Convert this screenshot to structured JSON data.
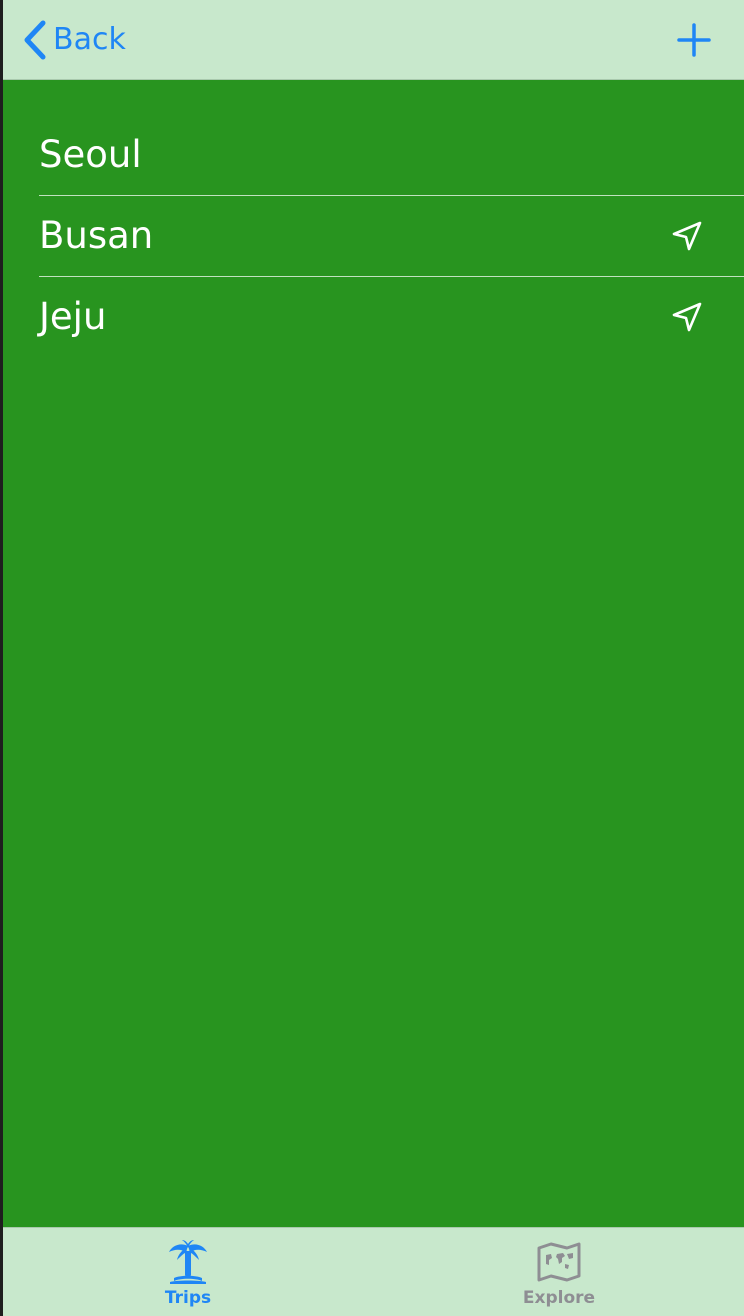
{
  "navbar": {
    "back_label": "Back",
    "back_icon": "chevron-left-icon",
    "add_icon": "plus-icon"
  },
  "list": {
    "items": [
      {
        "label": "Seoul",
        "has_location_icon": false
      },
      {
        "label": "Busan",
        "has_location_icon": true
      },
      {
        "label": "Jeju",
        "has_location_icon": true
      }
    ],
    "location_icon": "location-arrow-icon"
  },
  "tabbar": {
    "tabs": [
      {
        "label": "Trips",
        "icon": "palm-tree-icon",
        "selected": true
      },
      {
        "label": "Explore",
        "icon": "map-icon",
        "selected": false
      }
    ]
  },
  "colors": {
    "background": "#28941f",
    "bars": "#c8e8cc",
    "accent": "#1f86f5",
    "inactive": "#8e8e93",
    "text": "#ffffff"
  }
}
